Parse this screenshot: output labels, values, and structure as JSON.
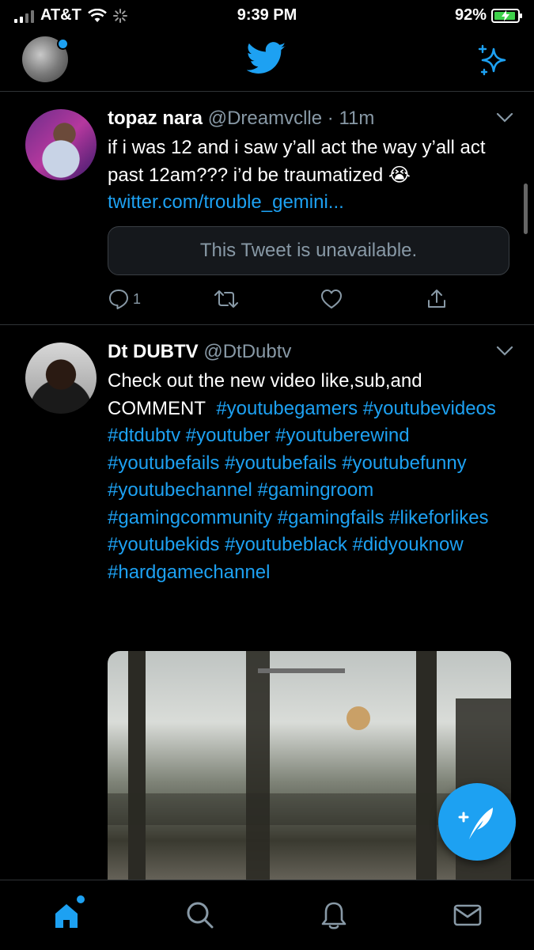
{
  "status_bar": {
    "carrier": "AT&T",
    "time": "9:39 PM",
    "battery_percent": "92%",
    "battery_level": 0.92
  },
  "header": {
    "logo_icon": "twitter-bird-icon",
    "sparkle_icon": "sparkle-icon"
  },
  "tweets": [
    {
      "name": "topaz nara",
      "handle": "@Dreamvclle",
      "separator": "·",
      "time": "11m",
      "text": "if i was 12 and i saw y’all act the way y’all act past 12am??? i’d be traumatized 😭",
      "link": "twitter.com/trouble_gemini...",
      "quoted_unavailable": "This Tweet is unavailable.",
      "reply_count": "1"
    },
    {
      "name": "Dt DUBTV",
      "handle": "@DtDubtv",
      "text_prefix": "Check out the new video like,sub,and COMMENT",
      "hashtags": "#youtubegamers #youtubevideos #dtdubtv #youtuber #youtuberewind #youtubefails #youtubefails #youtubefunny #youtubechannel #gamingroom #gamingcommunity #gamingfails #likeforlikes #youtubekids #youtubeblack #didyouknow #hardgamechannel"
    }
  ],
  "colors": {
    "accent": "#1da1f2",
    "muted": "#8899a6",
    "divider": "#2f3336"
  }
}
